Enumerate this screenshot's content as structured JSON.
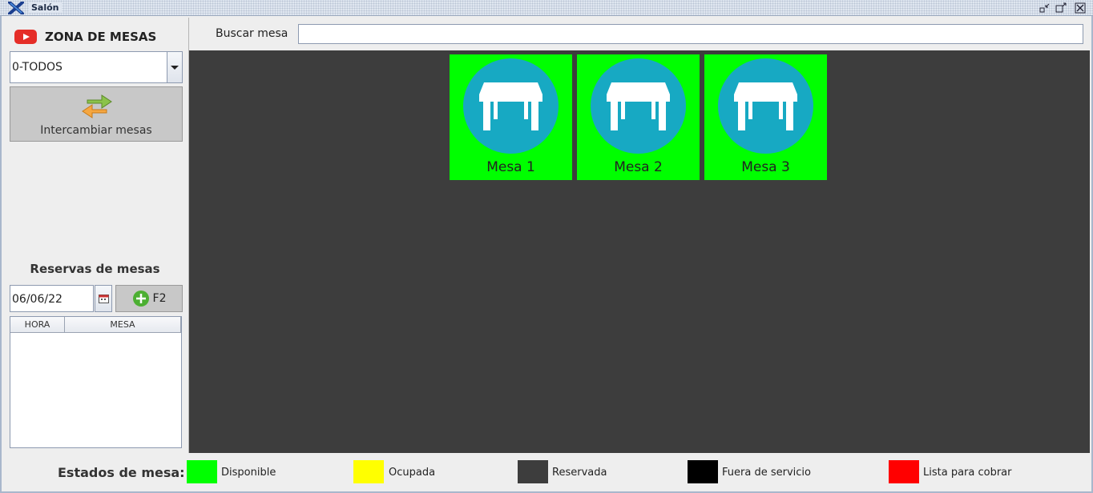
{
  "window": {
    "title": "Salón"
  },
  "sidebar": {
    "zone_title": "ZONA DE MESAS",
    "zone_select_value": "0-TODOS",
    "swap_button_label": "Intercambiar mesas",
    "reservations_title": "Reservas de mesas",
    "date_value": "06/06/22",
    "add_button_label": "F2",
    "reservations_table": {
      "columns": [
        "HORA",
        "MESA"
      ],
      "rows": []
    }
  },
  "search": {
    "label": "Buscar mesa",
    "value": ""
  },
  "tables": [
    {
      "label": "Mesa 1",
      "status": "Disponible"
    },
    {
      "label": "Mesa 2",
      "status": "Disponible"
    },
    {
      "label": "Mesa 3",
      "status": "Disponible"
    }
  ],
  "legend": {
    "title": "Estados de mesa:",
    "items": [
      {
        "label": "Disponible",
        "color": "#00ff00"
      },
      {
        "label": "Ocupada",
        "color": "#ffff00"
      },
      {
        "label": "Reservada",
        "color": "#3d3d3d"
      },
      {
        "label": "Fuera de servicio",
        "color": "#000000"
      },
      {
        "label": "Lista para cobrar",
        "color": "#ff0000"
      }
    ]
  },
  "colors": {
    "table_available": "#00ff00",
    "table_circle": "#17a9c3",
    "tables_background": "#3d3d3d"
  },
  "icons": {
    "app": "app-logo-icon",
    "zone": "youtube-icon",
    "swap": "swap-arrows-icon",
    "calendar": "calendar-icon",
    "add": "plus-circle-icon",
    "table": "table-furniture-icon"
  }
}
